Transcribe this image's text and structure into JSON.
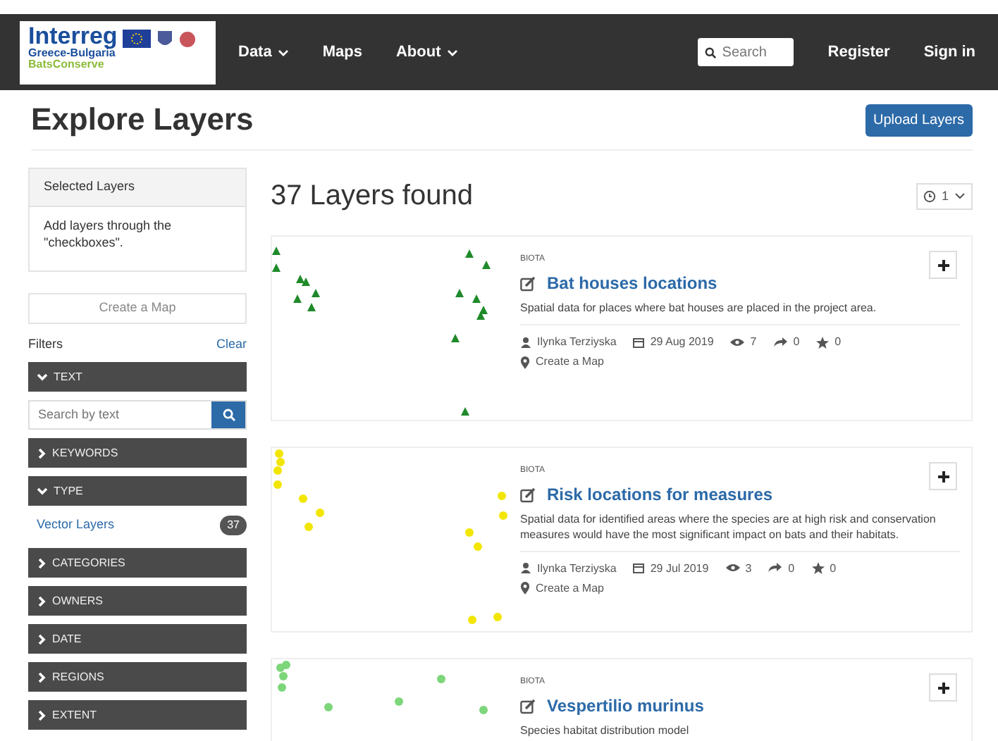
{
  "navbar": {
    "logo": {
      "title": "Interreg",
      "region": "Greece-Bulgaria",
      "project": "BatsConserve"
    },
    "menu": [
      {
        "label": "Data",
        "dropdown": true
      },
      {
        "label": "Maps",
        "dropdown": false
      },
      {
        "label": "About",
        "dropdown": true
      }
    ],
    "search": {
      "placeholder": "Search"
    },
    "links": [
      "Register",
      "Sign in"
    ]
  },
  "page": {
    "title": "Explore Layers",
    "upload_button": "Upload Layers"
  },
  "sidebar": {
    "selected_layers": {
      "title": "Selected Layers",
      "hint": "Add layers through the \"checkboxes\"."
    },
    "create_map": "Create a Map",
    "filters_label": "Filters",
    "clear": "Clear",
    "filters": [
      {
        "label": "TEXT",
        "expanded": true,
        "kind": "search",
        "placeholder": "Search by text"
      },
      {
        "label": "KEYWORDS",
        "expanded": false
      },
      {
        "label": "TYPE",
        "expanded": true,
        "kind": "list",
        "items": [
          {
            "label": "Vector Layers",
            "count": "37"
          }
        ]
      },
      {
        "label": "CATEGORIES",
        "expanded": false
      },
      {
        "label": "OWNERS",
        "expanded": false
      },
      {
        "label": "DATE",
        "expanded": false
      },
      {
        "label": "REGIONS",
        "expanded": false
      },
      {
        "label": "EXTENT",
        "expanded": false
      }
    ]
  },
  "results": {
    "heading": "37 Layers found",
    "sort_value": "1",
    "layers": [
      {
        "category": "BIOTA",
        "title": "Bat houses locations",
        "description": "Spatial data for places where bat houses are placed in the project area.",
        "author": "Ilynka Terziyska",
        "date": "29 Aug 2019",
        "views": "7",
        "shares": "0",
        "favorites": "0",
        "action": "Create a Map"
      },
      {
        "category": "BIOTA",
        "title": "Risk locations for measures",
        "description": "Spatial data for identified areas where the species are at high risk and conservation measures would have the most significant impact on bats and their habitats.",
        "author": "Ilynka Terziyska",
        "date": "29 Jul 2019",
        "views": "3",
        "shares": "0",
        "favorites": "0",
        "action": "Create a Map"
      },
      {
        "category": "BIOTA",
        "title": "Vespertilio murinus",
        "description": "Species habitat distribution model"
      }
    ]
  }
}
